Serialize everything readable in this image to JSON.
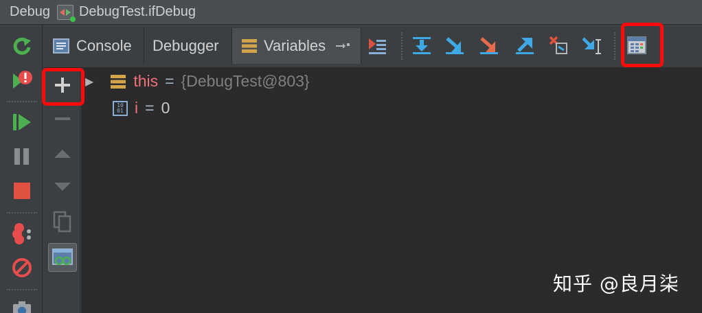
{
  "titlebar": {
    "panel_title": "Debug",
    "run_config": "DebugTest.ifDebug"
  },
  "tabs": {
    "console": "Console",
    "debugger": "Debugger",
    "variables": "Variables"
  },
  "variables": [
    {
      "expand_glyph": "▶",
      "name": "this",
      "eq": "=",
      "value": "{DebugTest@803}"
    },
    {
      "type_badge": "10\n01",
      "name": "i",
      "eq": "=",
      "value": "0"
    }
  ],
  "watermark": "知乎 @良月柒",
  "colors": {
    "var_name": "#f07178",
    "highlight": "#ff0a0a",
    "selected_tab": "#4b4f52"
  },
  "icons": {
    "left_toolbar": [
      "rerun-icon",
      "restart-error-icon",
      "resume-icon",
      "pause-icon",
      "stop-icon",
      "view-breakpoints-icon",
      "mute-breakpoints-icon",
      "camera-icon"
    ],
    "mid_toolbar": [
      "add-watch-icon",
      "remove-watch-icon",
      "move-up-icon",
      "move-down-icon",
      "copy-icon",
      "watches-glasses-icon"
    ],
    "tabs_toolbar": [
      "restore-layout-icon",
      "show-execution-point-icon",
      "step-over-icon",
      "step-into-icon",
      "force-step-into-icon",
      "step-out-icon",
      "drop-frame-icon",
      "run-to-cursor-icon",
      "evaluate-expression-icon"
    ]
  }
}
